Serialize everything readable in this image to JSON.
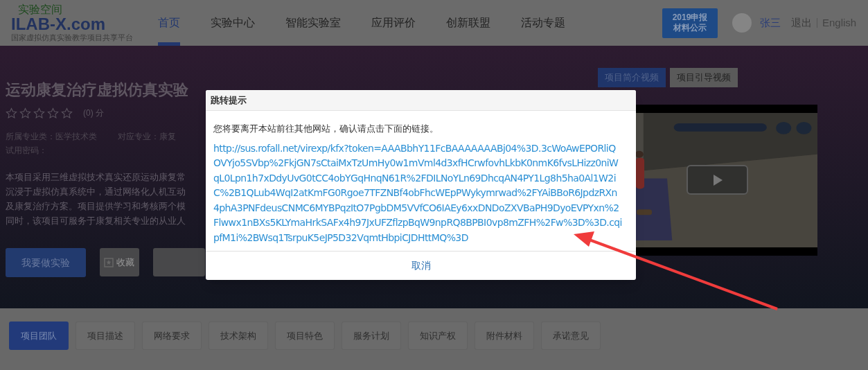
{
  "header": {
    "logo": {
      "tagline": "实验空间",
      "wordmark": "ILAB-X.com",
      "subtitle": "国家虚拟仿真实验教学项目共享平台"
    },
    "nav": [
      {
        "label": "首页",
        "selected": true
      },
      {
        "label": "实验中心",
        "selected": false
      },
      {
        "label": "智能实验室",
        "selected": false
      },
      {
        "label": "应用评价",
        "selected": false
      },
      {
        "label": "创新联盟",
        "selected": false
      },
      {
        "label": "活动专题",
        "selected": false
      }
    ],
    "banner": [
      "2019申报",
      "材料公示"
    ],
    "user": {
      "name": "张三",
      "logout": "退出",
      "language": "English"
    }
  },
  "project": {
    "title": "运动康复治疗虚拟仿真实验",
    "stars": 0,
    "score": "(0) 分",
    "fields": [
      "所属专业类：医学技术类",
      "对应专业：康复",
      "试用密码："
    ],
    "description": [
      "本项目采用三维虚拟技术真实还原运动康复常",
      "沉浸于虚拟仿真系统中，通过网络化人机互动",
      "及康复治疗方案。项目提供学习和考核两个模",
      "同时，该项目可服务于康复相关专业的从业人"
    ],
    "buttons": [
      {
        "kind": "primary",
        "label": "我要做实验"
      },
      {
        "kind": "favorite",
        "label": "收藏"
      },
      {
        "kind": "hidden"
      }
    ]
  },
  "video": {
    "tabs": [
      {
        "label": "项目简介视频",
        "selected": true
      },
      {
        "label": "项目引导视频",
        "selected": false
      }
    ]
  },
  "section_tabs": [
    {
      "label": "项目团队",
      "selected": true
    },
    {
      "label": "项目描述",
      "selected": false
    },
    {
      "label": "网络要求",
      "selected": false
    },
    {
      "label": "技术架构",
      "selected": false
    },
    {
      "label": "项目特色",
      "selected": false
    },
    {
      "label": "服务计划",
      "selected": false
    },
    {
      "label": "知识产权",
      "selected": false
    },
    {
      "label": "附件材料",
      "selected": false
    },
    {
      "label": "承诺意见",
      "selected": false
    }
  ],
  "dialog": {
    "title": "跳转提示",
    "message": "您将要离开本站前往其他网站，确认请点击下面的链接。",
    "link": "http://sus.rofall.net/virexp/kfx?token=AAABbhY11FcBAAAAAAABj04%3D.3cWoAwEPORliQOVYjo5SVbp%2FkjGN7sCtaiMxTzUmHy0w1mVml4d3xfHCrwfovhLkbK0nmK6fvsLHizz0niWqL0Lpn1h7xDdyUvG0tCC4obYGqHnqN61R%2FDILNoYLn69DhcqAN4PY1Lg8h5ha0Al1W2iC%2B1QLub4WqI2atKmFG0Rgoe7TFZNBf4obFhcWEpPWykymrwad%2FYAiBBoR6JpdzRXn4phA3PNFdeusCNMC6MYBPqzItO7PgbDM5VVfCO6IAEy6xxDNDoZXVBaPH9DyoEVPYxn%2Flwwx1nBXs5KLYmaHrkSAFx4h97JxUFZflzpBqW9npRQ8BPBI0vp8mZFH%2Fw%3D%3D.cqipfM1i%2BWsq1TsrpuK5eJP5D32VqmtHbpiCJDHttMQ%3D",
    "cancel": "取消"
  }
}
